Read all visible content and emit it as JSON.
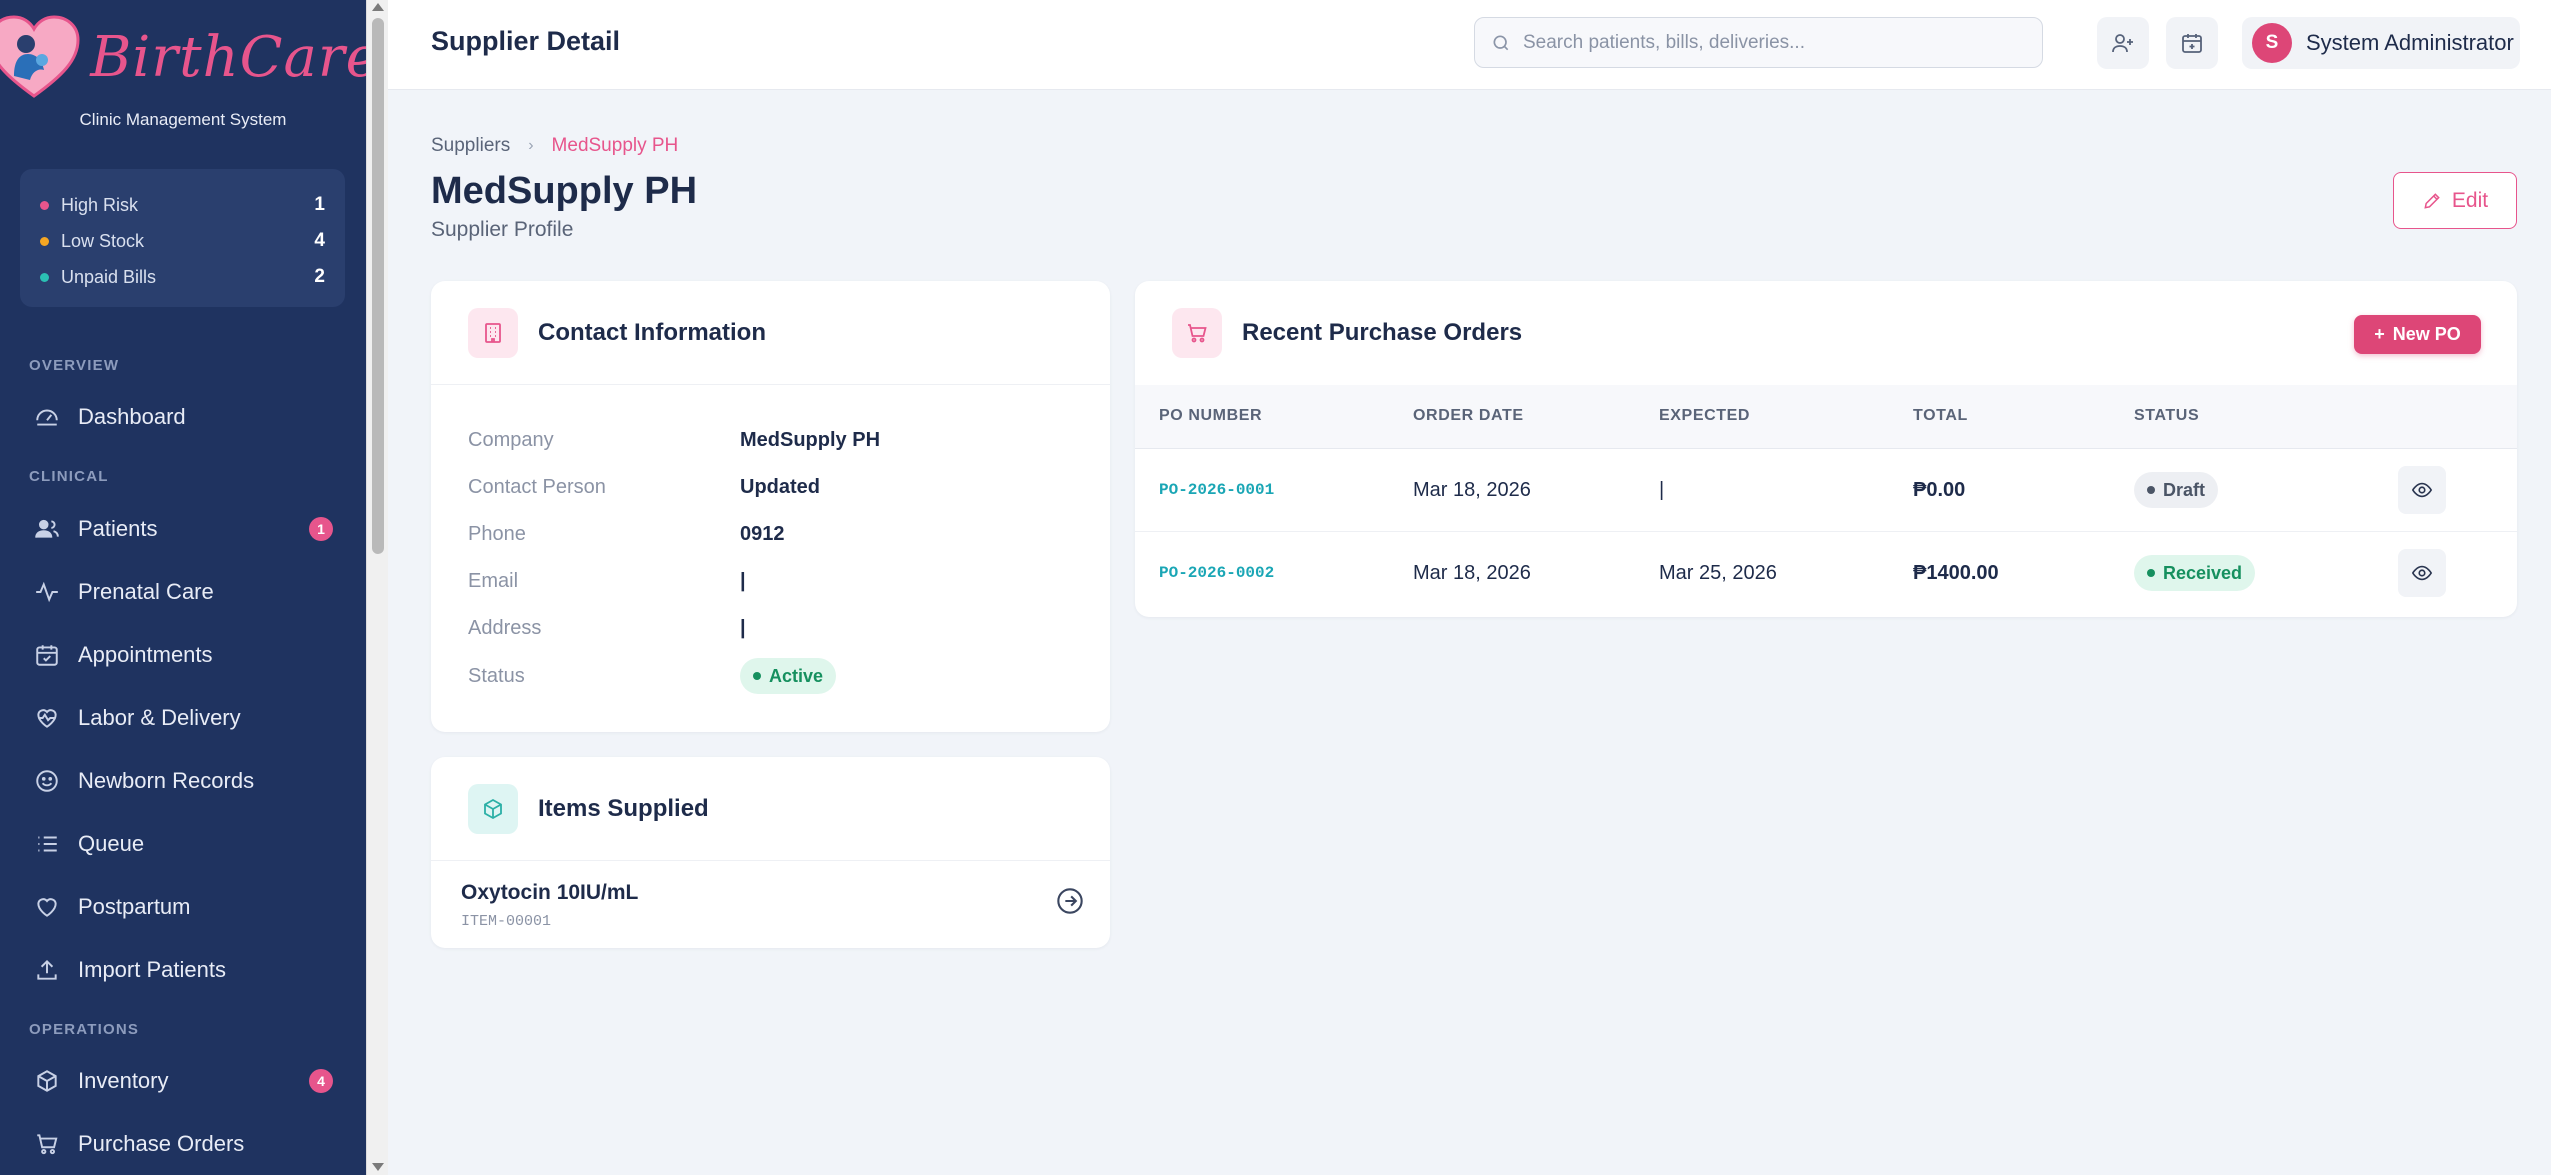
{
  "brand": {
    "name": "BirthCare",
    "subtitle": "Clinic Management System"
  },
  "quick_stats": [
    {
      "label": "High Risk",
      "count": "1",
      "color": "#e7558c"
    },
    {
      "label": "Low Stock",
      "count": "4",
      "color": "#f5a623"
    },
    {
      "label": "Unpaid Bills",
      "count": "2",
      "color": "#2bc0b4"
    }
  ],
  "sidebar": {
    "sections": {
      "overview": "OVERVIEW",
      "clinical": "CLINICAL",
      "operations": "OPERATIONS"
    },
    "items": [
      {
        "label": "Dashboard",
        "icon": "dashboard-icon"
      },
      {
        "label": "Patients",
        "icon": "users-icon",
        "badge": "1"
      },
      {
        "label": "Prenatal Care",
        "icon": "activity-icon"
      },
      {
        "label": "Appointments",
        "icon": "calendar-check-icon"
      },
      {
        "label": "Labor & Delivery",
        "icon": "heart-pulse-icon"
      },
      {
        "label": "Newborn Records",
        "icon": "smile-icon"
      },
      {
        "label": "Queue",
        "icon": "list-icon"
      },
      {
        "label": "Postpartum",
        "icon": "heart-icon"
      },
      {
        "label": "Import Patients",
        "icon": "upload-icon"
      },
      {
        "label": "Inventory",
        "icon": "box-icon",
        "badge": "4"
      },
      {
        "label": "Purchase Orders",
        "icon": "cart-icon"
      }
    ]
  },
  "header": {
    "title": "Supplier Detail",
    "search_placeholder": "Search patients, bills, deliveries...",
    "user_initial": "S",
    "user_name": "System Administrator"
  },
  "breadcrumb": {
    "parent": "Suppliers",
    "current": "MedSupply PH"
  },
  "page": {
    "title": "MedSupply PH",
    "subtitle": "Supplier Profile",
    "edit_label": "Edit"
  },
  "contact": {
    "title": "Contact Information",
    "rows": [
      {
        "label": "Company",
        "value": "MedSupply PH"
      },
      {
        "label": "Contact Person",
        "value": "Updated"
      },
      {
        "label": "Phone",
        "value": "0912"
      },
      {
        "label": "Email",
        "value": "|"
      },
      {
        "label": "Address",
        "value": "|"
      },
      {
        "label": "Status",
        "value": "Active"
      }
    ]
  },
  "items_supplied": {
    "title": "Items Supplied",
    "items": [
      {
        "name": "Oxytocin 10IU/mL",
        "code": "ITEM-00001"
      }
    ]
  },
  "purchase_orders": {
    "title": "Recent Purchase Orders",
    "new_label": "New PO",
    "columns": [
      "PO NUMBER",
      "ORDER DATE",
      "EXPECTED",
      "TOTAL",
      "STATUS"
    ],
    "rows": [
      {
        "po": "PO-2026-0001",
        "order_date": "Mar 18, 2026",
        "expected": "|",
        "total": "₱0.00",
        "status": "Draft"
      },
      {
        "po": "PO-2026-0002",
        "order_date": "Mar 18, 2026",
        "expected": "Mar 25, 2026",
        "total": "₱1400.00",
        "status": "Received"
      }
    ]
  }
}
